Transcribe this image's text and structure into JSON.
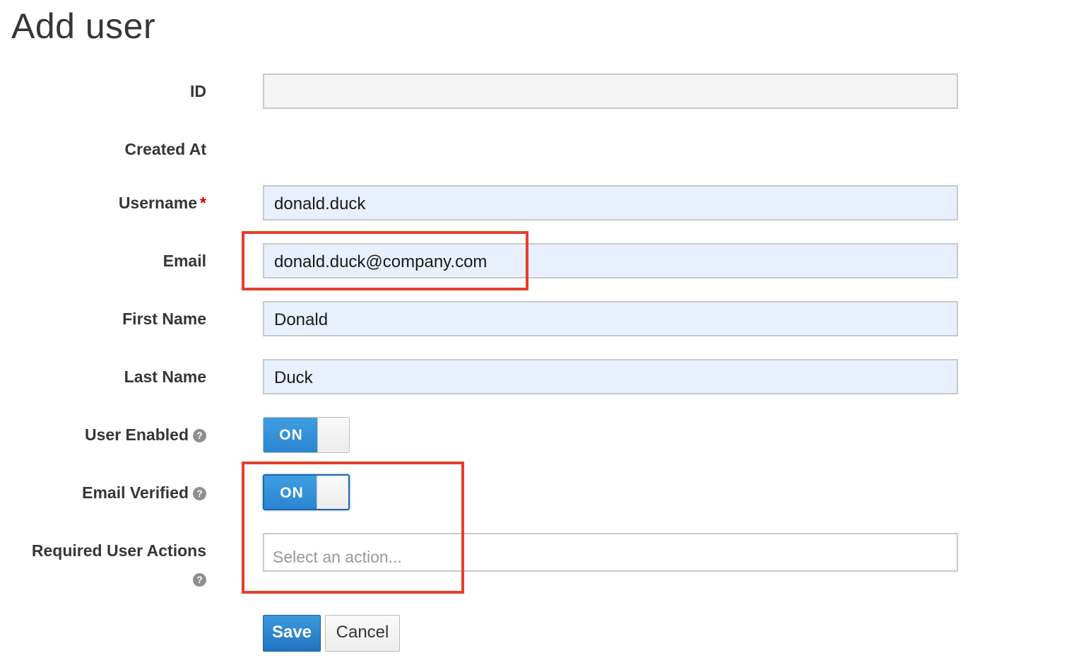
{
  "page": {
    "title": "Add user"
  },
  "form": {
    "id": {
      "label": "ID",
      "value": ""
    },
    "created_at": {
      "label": "Created At",
      "value": ""
    },
    "username": {
      "label": "Username",
      "required_mark": "*",
      "value": "donald.duck"
    },
    "email": {
      "label": "Email",
      "value": "donald.duck@company.com"
    },
    "first_name": {
      "label": "First Name",
      "value": "Donald"
    },
    "last_name": {
      "label": "Last Name",
      "value": "Duck"
    },
    "user_enabled": {
      "label": "User Enabled",
      "state": "ON",
      "help_icon": "question-circle-icon"
    },
    "email_verified": {
      "label": "Email Verified",
      "state": "ON",
      "help_icon": "question-circle-icon"
    },
    "required_actions": {
      "label": "Required User Actions",
      "placeholder": "Select an action...",
      "help_icon": "question-circle-icon"
    }
  },
  "actions": {
    "save_label": "Save",
    "cancel_label": "Cancel"
  },
  "colors": {
    "accent": "#2a86cf",
    "highlight": "#e2402c",
    "required": "#cc0000",
    "autofill_bg": "#e8f0fe"
  }
}
